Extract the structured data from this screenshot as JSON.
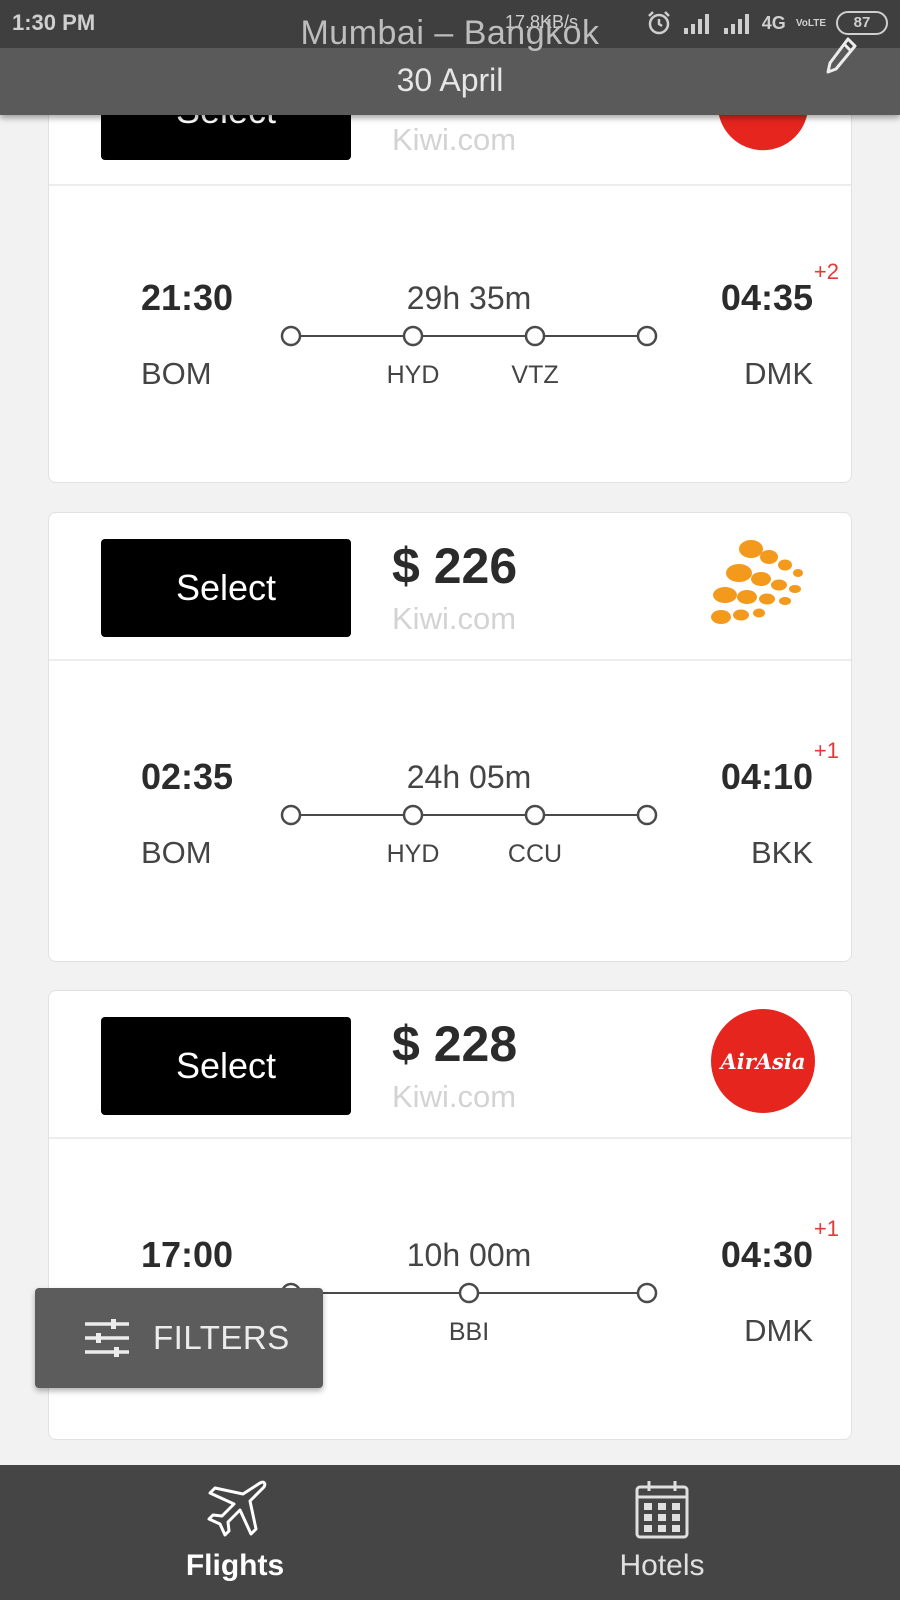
{
  "status_bar": {
    "time": "1:30 PM",
    "network_speed": "17.8KB/s",
    "network_type": "4G",
    "carrier_badge": "VoLTE",
    "battery": "87",
    "icons": [
      "alarm-icon",
      "signal-icon",
      "signal-icon",
      "battery-icon"
    ]
  },
  "header": {
    "route": "Mumbai – Bangkok",
    "date": "30 April",
    "edit_icon": "pencil-icon"
  },
  "colors": {
    "header_bg": "#5a5a5a",
    "status_bg": "#3f3f3f",
    "select_button": "#000000",
    "day_offset": "#e53935",
    "airasia_red": "#e5251e",
    "nokair_orange": "#f39a1d",
    "bottom_nav_bg": "#454545"
  },
  "flights": [
    {
      "select_label": "Select",
      "price": "",
      "provider": "Kiwi.com",
      "airline_logo": "red-circle-airline-logo",
      "dep_time": "21:30",
      "dep_code": "BOM",
      "arr_time": "04:35",
      "arr_code": "DMK",
      "day_offset": "+2",
      "duration": "29h 35m",
      "stops": [
        "HYD",
        "VTZ"
      ]
    },
    {
      "select_label": "Select",
      "price": "$ 226",
      "provider": "Kiwi.com",
      "airline_logo": "orange-dots-airline-logo",
      "dep_time": "02:35",
      "dep_code": "BOM",
      "arr_time": "04:10",
      "arr_code": "BKK",
      "day_offset": "+1",
      "duration": "24h 05m",
      "stops": [
        "HYD",
        "CCU"
      ]
    },
    {
      "select_label": "Select",
      "price": "$ 228",
      "provider": "Kiwi.com",
      "airline_logo": "airasia-logo",
      "logo_text": "AirAsia",
      "dep_time": "17:00",
      "dep_code": "",
      "arr_time": "04:30",
      "arr_code": "DMK",
      "day_offset": "+1",
      "duration": "10h 00m",
      "stops": [
        "BBI"
      ]
    }
  ],
  "filters": {
    "label": "FILTERS",
    "icon": "sliders-icon"
  },
  "bottom_nav": {
    "items": [
      {
        "label": "Flights",
        "icon": "airplane-icon",
        "active": true
      },
      {
        "label": "Hotels",
        "icon": "calendar-building-icon",
        "active": false
      }
    ]
  }
}
